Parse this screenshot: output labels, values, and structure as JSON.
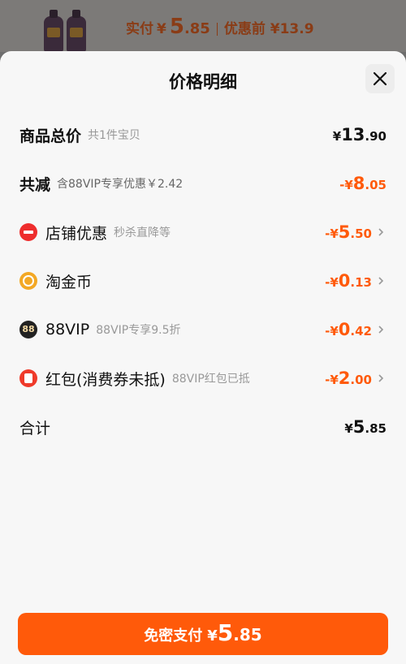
{
  "banner": {
    "pay_label": "实付",
    "currency": "¥",
    "pay_int": "5",
    "pay_dec": ".85",
    "orig_label": "优惠前 ¥13.9"
  },
  "sheet": {
    "title": "价格明细",
    "close_icon": "close-icon"
  },
  "rows": {
    "total": {
      "name": "商品总价",
      "desc": "共1件宝贝",
      "yen": "¥",
      "int": "13",
      "dec": ".90"
    },
    "reduction": {
      "name": "共减",
      "desc": "含88VIP专享优惠￥2.42",
      "yen": "-¥",
      "int": "8",
      "dec": ".05"
    },
    "store": {
      "name": "店铺优惠",
      "desc": "秒杀直降等",
      "yen": "-¥",
      "int": "5",
      "dec": ".50",
      "icon": "store-discount-icon"
    },
    "coin": {
      "name": "淘金币",
      "desc": "",
      "yen": "-¥",
      "int": "0",
      "dec": ".13",
      "icon": "coin-icon"
    },
    "vip": {
      "name": "88VIP",
      "desc": "88VIP专享9.5折",
      "yen": "-¥",
      "int": "0",
      "dec": ".42",
      "icon_text": "88"
    },
    "redpacket": {
      "name": "红包(消费券未抵)",
      "desc": "88VIP红包已抵",
      "yen": "-¥",
      "int": "2",
      "dec": ".00",
      "icon": "red-packet-icon"
    },
    "sum": {
      "name": "合计",
      "yen": "¥",
      "int": "5",
      "dec": ".85"
    }
  },
  "pay_button": {
    "label": "免密支付",
    "yen": "¥",
    "int": "5",
    "dec": ".85"
  },
  "colors": {
    "accent": "#ff5a0a",
    "sheet_bg": "#f7f7f7"
  }
}
